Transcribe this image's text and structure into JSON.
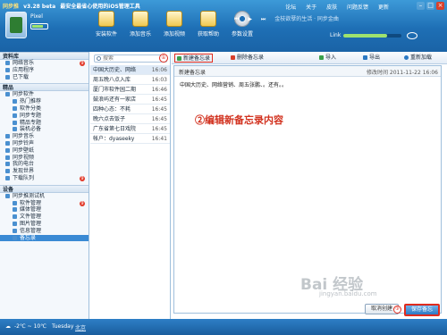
{
  "app": {
    "title_prefix": "同步推",
    "version": "v3.28 beta",
    "tagline": "最安全最省心使用的iOS管理工具"
  },
  "top_links": [
    "论坛",
    "关于",
    "皮肤",
    "问题反馈",
    "更新"
  ],
  "device": {
    "name": "Pixel",
    "battery_level": 0.6
  },
  "toolbar_buttons": [
    {
      "label": "安装软件",
      "icon": "box-icon"
    },
    {
      "label": "添加音乐",
      "icon": "music-icon"
    },
    {
      "label": "添加视频",
      "icon": "video-icon"
    },
    {
      "label": "获取帮助",
      "icon": "help-icon"
    },
    {
      "label": "参数设置",
      "icon": "gear-icon"
    }
  ],
  "player": {
    "prev": "⏮",
    "play": "▶",
    "next": "⏭",
    "track": "金枝欲孽的生活 · 同步金曲"
  },
  "link": {
    "label": "Link",
    "level": 0.75
  },
  "sidebar": {
    "resources_head": "资料库",
    "resources": [
      {
        "label": "网络音乐",
        "badge": "9"
      },
      {
        "label": "应用程序",
        "badge": ""
      },
      {
        "label": "已下载",
        "badge": ""
      }
    ],
    "recommend_head": "精品",
    "recommend": [
      {
        "label": "同步软件",
        "level": 1
      },
      {
        "label": "热门推荐",
        "level": 2
      },
      {
        "label": "软件分类",
        "level": 2
      },
      {
        "label": "同步专题",
        "level": 2
      },
      {
        "label": "精品专题",
        "level": 2
      },
      {
        "label": "装机必备",
        "level": 2
      },
      {
        "label": "同步音乐",
        "level": 1
      },
      {
        "label": "同步铃声",
        "level": 1
      },
      {
        "label": "同步壁纸",
        "level": 1
      },
      {
        "label": "同步视频",
        "level": 1
      },
      {
        "label": "我的电台",
        "level": 1
      },
      {
        "label": "发现世界",
        "level": 1
      },
      {
        "label": "下载队列",
        "level": 1,
        "badge": "9"
      }
    ],
    "device_head": "设备",
    "device_items": [
      {
        "label": "同步推测试机",
        "level": 1
      },
      {
        "label": "软件管理",
        "level": 2,
        "badge": "9"
      },
      {
        "label": "媒体管理",
        "level": 2
      },
      {
        "label": "文件管理",
        "level": 2
      },
      {
        "label": "图片管理",
        "level": 2
      },
      {
        "label": "信息管理",
        "level": 2
      },
      {
        "label": "备忘录",
        "level": 2,
        "active": true
      }
    ]
  },
  "search": {
    "placeholder": "搜索"
  },
  "steps": {
    "one": "①",
    "two": "②",
    "three": "③"
  },
  "notes": [
    {
      "text": "中国大历史、网络",
      "time": "16:06"
    },
    {
      "text": "周五晚八点入库",
      "time": "16:03"
    },
    {
      "text": "厦门市软件园二期",
      "time": "16:46"
    },
    {
      "text": "鼓浪屿还有一家店",
      "time": "16:45"
    },
    {
      "text": "四种心态：不耗",
      "time": "16:45"
    },
    {
      "text": "晚六点去饭子",
      "time": "16:45"
    },
    {
      "text": "广东省第七日戏院",
      "time": "16:45"
    },
    {
      "text": "帐户：dyaseeky",
      "time": "16:41"
    }
  ],
  "tools": {
    "new": "新建备忘录",
    "delete": "删除备忘录",
    "import": "导入",
    "export": "导出",
    "refresh": "重新加载"
  },
  "editor": {
    "title": "新建备忘录",
    "modified_label": "修改时间",
    "modified_time": "2011-11-22 16:06",
    "content": "中国大历史、网络营销、周五张鹏、。还有。。",
    "annotation": "编辑新备忘录内容"
  },
  "buttons": {
    "cancel": "取消创建",
    "save": "保存备忘"
  },
  "watermark": {
    "main": "Bai 经验",
    "site": "jingyan.baidu.com"
  },
  "status": {
    "temp": "-2℃ ~ 10℃",
    "day": "Tuesday",
    "link": "北京"
  }
}
